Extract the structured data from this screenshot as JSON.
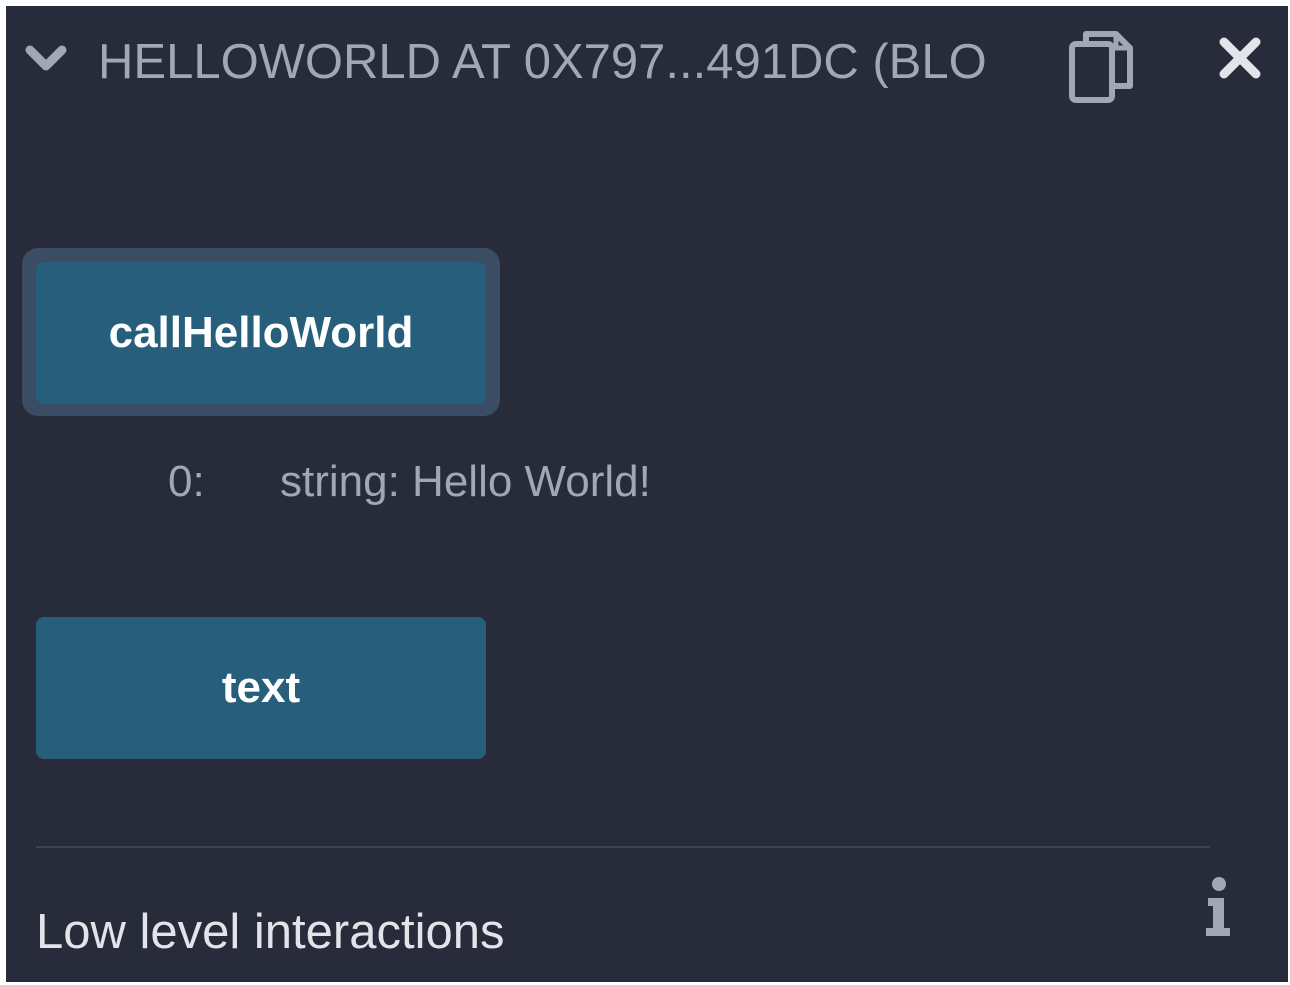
{
  "header": {
    "title": "HELLOWORLD AT 0X797...491DC (BLO",
    "expand_icon": "chevron-down-icon",
    "copy_icon": "copy-icon",
    "close_icon": "close-icon"
  },
  "functions": [
    {
      "label": "callHelloWorld"
    },
    {
      "label": "text"
    }
  ],
  "result": {
    "index": "0:",
    "value": "string: Hello World!"
  },
  "low_level": {
    "title": "Low level interactions",
    "info_icon": "info-icon"
  },
  "colors": {
    "panel_background": "#272b3a",
    "button_background": "#265e7b",
    "button_focus_ring": "#3a4d64",
    "muted_text": "#a2a6b6",
    "heading_text": "#e2e4ea"
  }
}
